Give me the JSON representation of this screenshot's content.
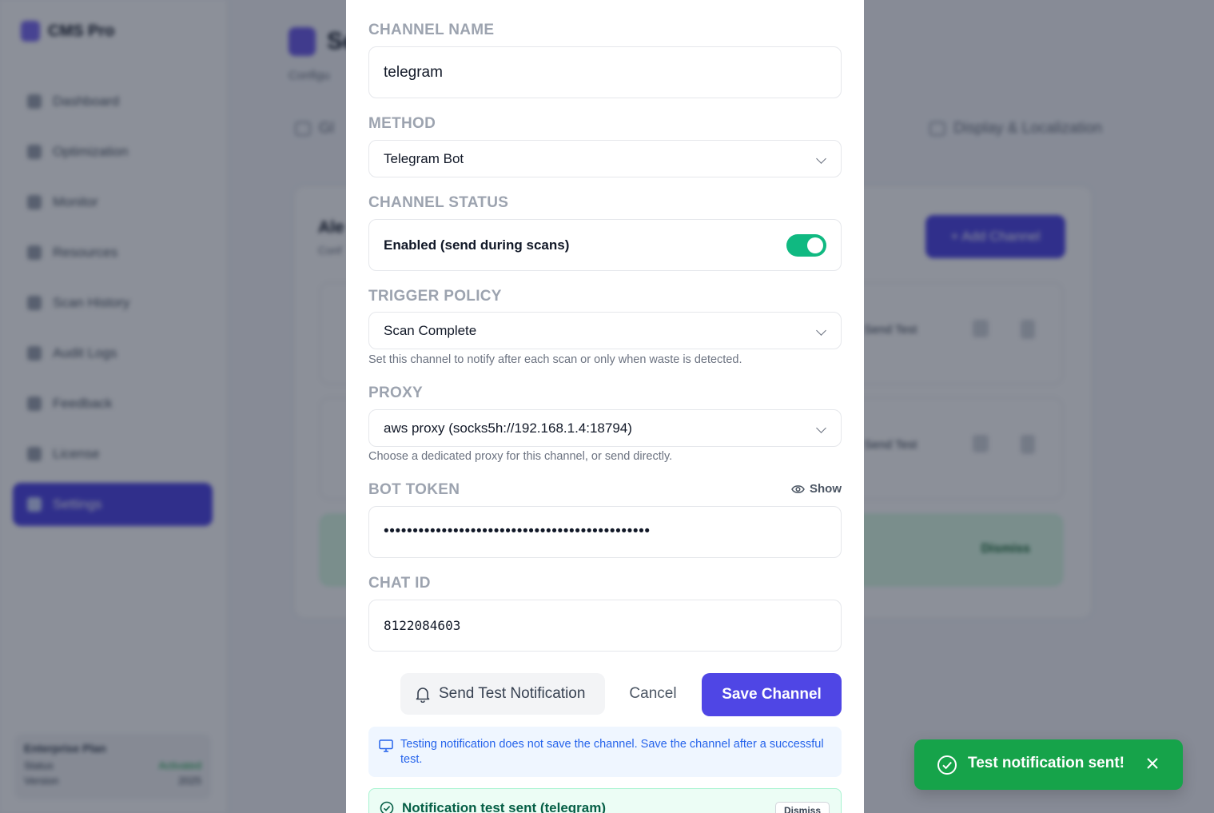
{
  "app": {
    "name": "CMS Pro",
    "nav": [
      {
        "label": "Dashboard"
      },
      {
        "label": "Optimization"
      },
      {
        "label": "Monitor"
      },
      {
        "label": "Resources"
      },
      {
        "label": "Scan History"
      },
      {
        "label": "Audit Logs"
      },
      {
        "label": "Feedback"
      },
      {
        "label": "License"
      },
      {
        "label": "Settings"
      }
    ],
    "plan": {
      "title": "Enterprise Plan",
      "status_label": "Status",
      "status_value": "Activated",
      "version_label": "Version",
      "version_value": "2025"
    }
  },
  "page": {
    "title": "Se",
    "subtitle": "Configu",
    "tabs": [
      {
        "label": "Gl"
      },
      {
        "label": "Display & Localization"
      }
    ],
    "panel_title": "Ale",
    "panel_sub": "Conf",
    "add_button": "+ Add Channel",
    "row_test": "Send Test",
    "strip_dismiss": "Dismiss"
  },
  "modal": {
    "channel_name": {
      "label": "CHANNEL NAME",
      "value": "telegram"
    },
    "method": {
      "label": "METHOD",
      "value": "Telegram Bot"
    },
    "status": {
      "label": "CHANNEL STATUS",
      "text": "Enabled (send during scans)",
      "enabled": true
    },
    "trigger": {
      "label": "TRIGGER POLICY",
      "value": "Scan Complete",
      "help": "Set this channel to notify after each scan or only when waste is detected."
    },
    "proxy": {
      "label": "PROXY",
      "value": "aws proxy (socks5h://192.168.1.4:18794)",
      "help": "Choose a dedicated proxy for this channel, or send directly."
    },
    "bot_token": {
      "label": "BOT TOKEN",
      "show_label": "Show",
      "masked": "••••••••••••••••••••••••••••••••••••••••••••••"
    },
    "chat_id": {
      "label": "CHAT ID",
      "value": "8122084603"
    },
    "buttons": {
      "test": "Send Test Notification",
      "cancel": "Cancel",
      "save": "Save Channel"
    },
    "info": "Testing notification does not save the channel. Save the channel after a successful test.",
    "success": {
      "text": "Notification test sent (telegram)",
      "dismiss": "Dismiss"
    }
  },
  "toast": {
    "text": "Test notification sent!"
  },
  "colors": {
    "accent": "#4f46e5",
    "success": "#16a34a",
    "toggle_on": "#10b981",
    "info": "#2563eb"
  }
}
